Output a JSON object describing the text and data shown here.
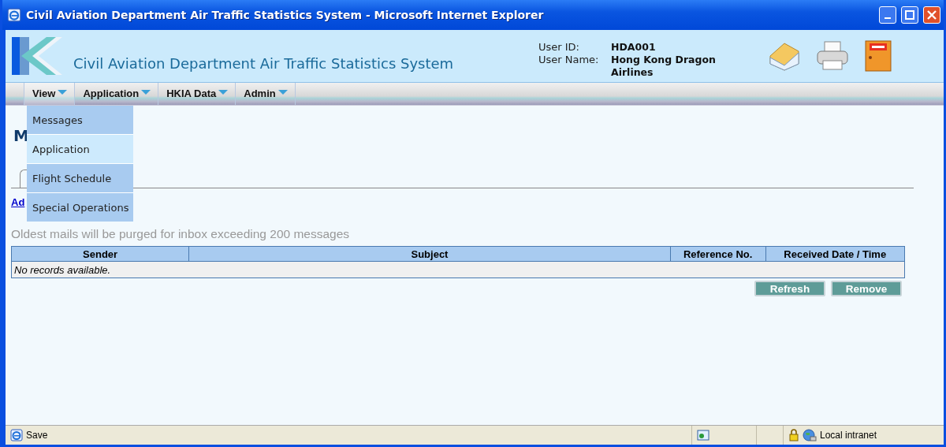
{
  "window": {
    "title": "Civil Aviation Department Air Traffic Statistics System - Microsoft Internet Explorer"
  },
  "header": {
    "title": "Civil Aviation Department Air Traffic Statistics System",
    "user_id_label": "User ID:",
    "user_id": "HDA001",
    "user_name_label": "User Name:",
    "user_name": "Hong Kong Dragon Airlines"
  },
  "menu": [
    {
      "label": "View",
      "expanded": true
    },
    {
      "label": "Application",
      "expanded": false
    },
    {
      "label": "HKIA Data",
      "expanded": false
    },
    {
      "label": "Admin",
      "expanded": false
    }
  ],
  "dropdown": [
    {
      "label": "Messages",
      "selected": false
    },
    {
      "label": "Application",
      "selected": true
    },
    {
      "label": "Flight Schedule",
      "selected": false
    },
    {
      "label": "Special Operations",
      "selected": false
    }
  ],
  "page": {
    "heading": "M",
    "link": "Ad",
    "note": "Oldest mails will be purged for inbox exceeding 200 messages"
  },
  "table": {
    "columns": [
      "Sender",
      "Subject",
      "Reference No.",
      "Received Date / Time"
    ],
    "empty_message": "No records available."
  },
  "buttons": [
    "Refresh",
    "Remove"
  ],
  "status_bar": {
    "text": "Save",
    "zone": "Local intranet"
  }
}
